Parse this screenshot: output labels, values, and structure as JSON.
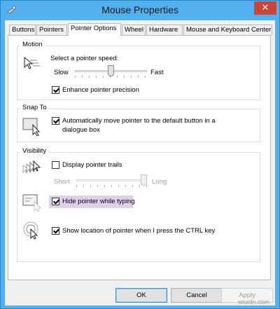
{
  "window": {
    "title": "Mouse Properties",
    "close_glyph": "✕",
    "accent_color": "#53b0ef"
  },
  "tabs": [
    {
      "label": "Buttons",
      "active": false
    },
    {
      "label": "Pointers",
      "active": false
    },
    {
      "label": "Pointer Options",
      "active": true
    },
    {
      "label": "Wheel",
      "active": false
    },
    {
      "label": "Hardware",
      "active": false
    },
    {
      "label": "Mouse and Keyboard Center",
      "active": false
    }
  ],
  "motion": {
    "group_label": "Motion",
    "icon": "pointer-speed-icon",
    "speed_label": "Select a pointer speed:",
    "slow_label": "Slow",
    "fast_label": "Fast",
    "speed_level": 0.5,
    "precision_label": "Enhance pointer precision",
    "precision_checked": true
  },
  "snap_to": {
    "group_label": "Snap To",
    "icon": "snap-to-icon",
    "snap_label_line1": "Automatically move pointer to the default button in a",
    "snap_label_line2": "dialogue box",
    "snap_checked": true
  },
  "visibility": {
    "group_label": "Visibility",
    "trails_icon": "pointer-trails-icon",
    "trails_label": "Display pointer trails",
    "trails_checked": false,
    "short_label": "Short",
    "long_label": "Long",
    "trails_level": 1.0,
    "hide_icon": "hide-pointer-icon",
    "hide_label": "Hide pointer while typing",
    "hide_checked": true,
    "ctrl_icon": "ctrl-location-icon",
    "ctrl_label": "Show location of pointer when I press the CTRL key",
    "ctrl_checked": true
  },
  "buttons": {
    "ok_label": "OK",
    "cancel_label": "Cancel",
    "apply_label": "Apply"
  },
  "watermark": "wsxdn.com"
}
